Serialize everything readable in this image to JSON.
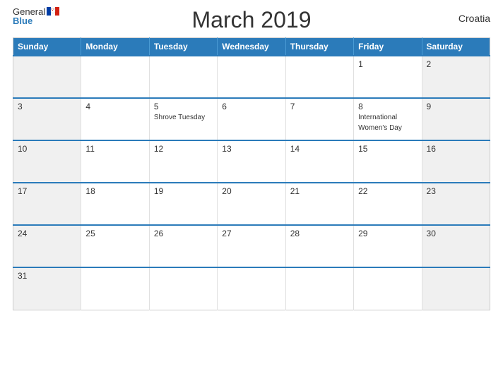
{
  "header": {
    "title": "March 2019",
    "country": "Croatia",
    "logo": {
      "general": "General",
      "blue": "Blue"
    }
  },
  "calendar": {
    "weekdays": [
      "Sunday",
      "Monday",
      "Tuesday",
      "Wednesday",
      "Thursday",
      "Friday",
      "Saturday"
    ],
    "weeks": [
      [
        {
          "day": "",
          "event": "",
          "weekend": true
        },
        {
          "day": "",
          "event": "",
          "weekend": false
        },
        {
          "day": "",
          "event": "",
          "weekend": false
        },
        {
          "day": "",
          "event": "",
          "weekend": false
        },
        {
          "day": "",
          "event": "",
          "weekend": false
        },
        {
          "day": "1",
          "event": "",
          "weekend": false
        },
        {
          "day": "2",
          "event": "",
          "weekend": true
        }
      ],
      [
        {
          "day": "3",
          "event": "",
          "weekend": true
        },
        {
          "day": "4",
          "event": "",
          "weekend": false
        },
        {
          "day": "5",
          "event": "Shrove Tuesday",
          "weekend": false
        },
        {
          "day": "6",
          "event": "",
          "weekend": false
        },
        {
          "day": "7",
          "event": "",
          "weekend": false
        },
        {
          "day": "8",
          "event": "International Women's Day",
          "weekend": false
        },
        {
          "day": "9",
          "event": "",
          "weekend": true
        }
      ],
      [
        {
          "day": "10",
          "event": "",
          "weekend": true
        },
        {
          "day": "11",
          "event": "",
          "weekend": false
        },
        {
          "day": "12",
          "event": "",
          "weekend": false
        },
        {
          "day": "13",
          "event": "",
          "weekend": false
        },
        {
          "day": "14",
          "event": "",
          "weekend": false
        },
        {
          "day": "15",
          "event": "",
          "weekend": false
        },
        {
          "day": "16",
          "event": "",
          "weekend": true
        }
      ],
      [
        {
          "day": "17",
          "event": "",
          "weekend": true
        },
        {
          "day": "18",
          "event": "",
          "weekend": false
        },
        {
          "day": "19",
          "event": "",
          "weekend": false
        },
        {
          "day": "20",
          "event": "",
          "weekend": false
        },
        {
          "day": "21",
          "event": "",
          "weekend": false
        },
        {
          "day": "22",
          "event": "",
          "weekend": false
        },
        {
          "day": "23",
          "event": "",
          "weekend": true
        }
      ],
      [
        {
          "day": "24",
          "event": "",
          "weekend": true
        },
        {
          "day": "25",
          "event": "",
          "weekend": false
        },
        {
          "day": "26",
          "event": "",
          "weekend": false
        },
        {
          "day": "27",
          "event": "",
          "weekend": false
        },
        {
          "day": "28",
          "event": "",
          "weekend": false
        },
        {
          "day": "29",
          "event": "",
          "weekend": false
        },
        {
          "day": "30",
          "event": "",
          "weekend": true
        }
      ],
      [
        {
          "day": "31",
          "event": "",
          "weekend": true
        },
        {
          "day": "",
          "event": "",
          "weekend": false
        },
        {
          "day": "",
          "event": "",
          "weekend": false
        },
        {
          "day": "",
          "event": "",
          "weekend": false
        },
        {
          "day": "",
          "event": "",
          "weekend": false
        },
        {
          "day": "",
          "event": "",
          "weekend": false
        },
        {
          "day": "",
          "event": "",
          "weekend": true
        }
      ]
    ]
  }
}
